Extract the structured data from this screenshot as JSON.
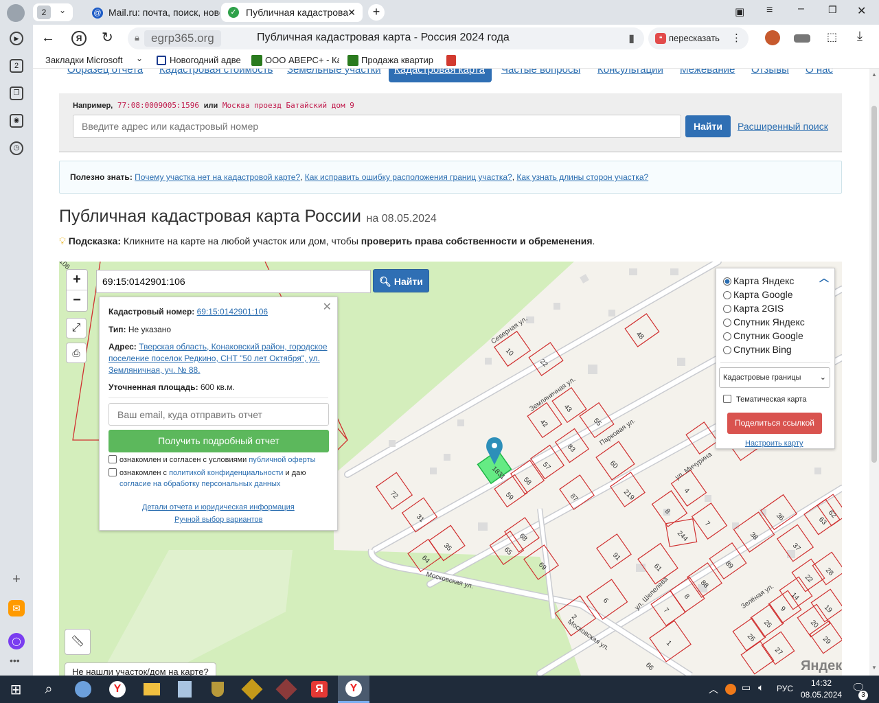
{
  "browser": {
    "tab_count": "2",
    "tabs": [
      {
        "label": "Mail.ru: почта, поиск, новс",
        "icon": "mail-icon"
      },
      {
        "label": "Публичная кадастрова",
        "icon": "check-icon"
      }
    ],
    "domain": "egrp365.org",
    "page_title": "Публичная кадастровая карта - Россия 2024 года",
    "retell_label": "пересказать",
    "bookmarks": [
      "Закладки Microsoft",
      "Новогодний адве",
      "ООО АВЕРС+ - Ка",
      "Продажа квартир"
    ]
  },
  "sidebar": {
    "badge": "2"
  },
  "site_nav": [
    "Образец отчета",
    "Кадастровая стоимость",
    "Земельные участки",
    "Кадастровая карта",
    "Частые вопросы",
    "Консультации",
    "Межевание",
    "Отзывы",
    "О нас"
  ],
  "search": {
    "example_prefix": "Например,",
    "example_number": "77:08:0009005:1596",
    "example_or": "или",
    "example_address": "Москва проезд Батайский дом 9",
    "placeholder": "Введите адрес или кадастровый номер",
    "find_label": "Найти",
    "advanced_label": "Расширенный поиск"
  },
  "useful": {
    "prefix": "Полезно знать:",
    "links": [
      "Почему участка нет на кадастровой карте?",
      "Как исправить ошибку расположения границ участка?",
      "Как узнать длины сторон участка?"
    ]
  },
  "heading": {
    "title": "Публичная кадастровая карта России",
    "date": "на 08.05.2024"
  },
  "hint": {
    "label": "Подсказка:",
    "text": "Кликните на карте на любой участок или дом, чтобы",
    "bold": "проверить права собственности и обременения",
    "end": "."
  },
  "map": {
    "search_value": "69:15:0142901:106",
    "find_label": "Найти",
    "zoom_in": "+",
    "zoom_out": "−",
    "not_found": "Не нашли участок/дом на карте?",
    "watermark": "Яндекс",
    "layers": [
      "Карта Яндекс",
      "Карта Google",
      "Карта 2GIS",
      "Спутник Яндекс",
      "Спутник Google",
      "Спутник Bing"
    ],
    "boundary_select": "Кадастровые границы",
    "thematic": "Тематическая карта",
    "share": "Поделиться ссылкой",
    "configure": "Настроить карту",
    "streets": [
      "Северная ул.",
      "Земляничная ул.",
      "Парковая ул.",
      "ул. Мичурина",
      "Московская ул.",
      "Московская ул.",
      "ул. Шепелева",
      "Зелёная ул."
    ],
    "parcels": [
      "10",
      "22",
      "48",
      "43",
      "42",
      "55",
      "83",
      "57",
      "58",
      "59",
      "60",
      "219",
      "87",
      "72",
      "31",
      "35",
      "64",
      "65",
      "68",
      "69",
      "91",
      "4",
      "8",
      "7",
      "244",
      "36",
      "38",
      "37",
      "63",
      "62",
      "61",
      "89",
      "88",
      "8",
      "7",
      "6",
      "2",
      "1",
      "14",
      "22",
      "9",
      "25",
      "26",
      "20",
      "19",
      "27",
      "28",
      "29",
      "66",
      "1831",
      "106"
    ]
  },
  "popup": {
    "cad_label": "Кадастровый номер:",
    "cad_value": "69:15:0142901:106",
    "type_label": "Тип:",
    "type_value": "Не указано",
    "addr_label": "Адрес:",
    "addr_value": "Тверская область, Конаковский район, городское поселение поселок Редкино, СНТ \"50 лет Октября\", ул. Земляничная, уч. № 88.",
    "area_label": "Уточненная площадь:",
    "area_value": "600 кв.м.",
    "email_placeholder": "Ваш email, куда отправить отчет",
    "report_btn": "Получить подробный отчет",
    "agree1_text": "ознакомлен и согласен с условиями",
    "agree1_link": "публичной оферты",
    "agree2_text": "ознакомлен с",
    "agree2_link": "политикой конфиденциальности",
    "agree2_mid": "и даю",
    "agree2_link2": "согласие на обработку персональных данных",
    "details_link": "Детали отчета и юридическая информация",
    "manual_link": "Ручной выбор вариантов"
  },
  "taskbar": {
    "lang": "РУС",
    "time": "14:32",
    "date": "08.05.2024",
    "notif": "3"
  },
  "colors": {
    "accent": "#2f6fb4",
    "green": "#5cb85c",
    "red": "#d9534f",
    "map_green": "#d4eebc",
    "map_bg": "#f4f2ec",
    "parcel": "#d03030"
  }
}
